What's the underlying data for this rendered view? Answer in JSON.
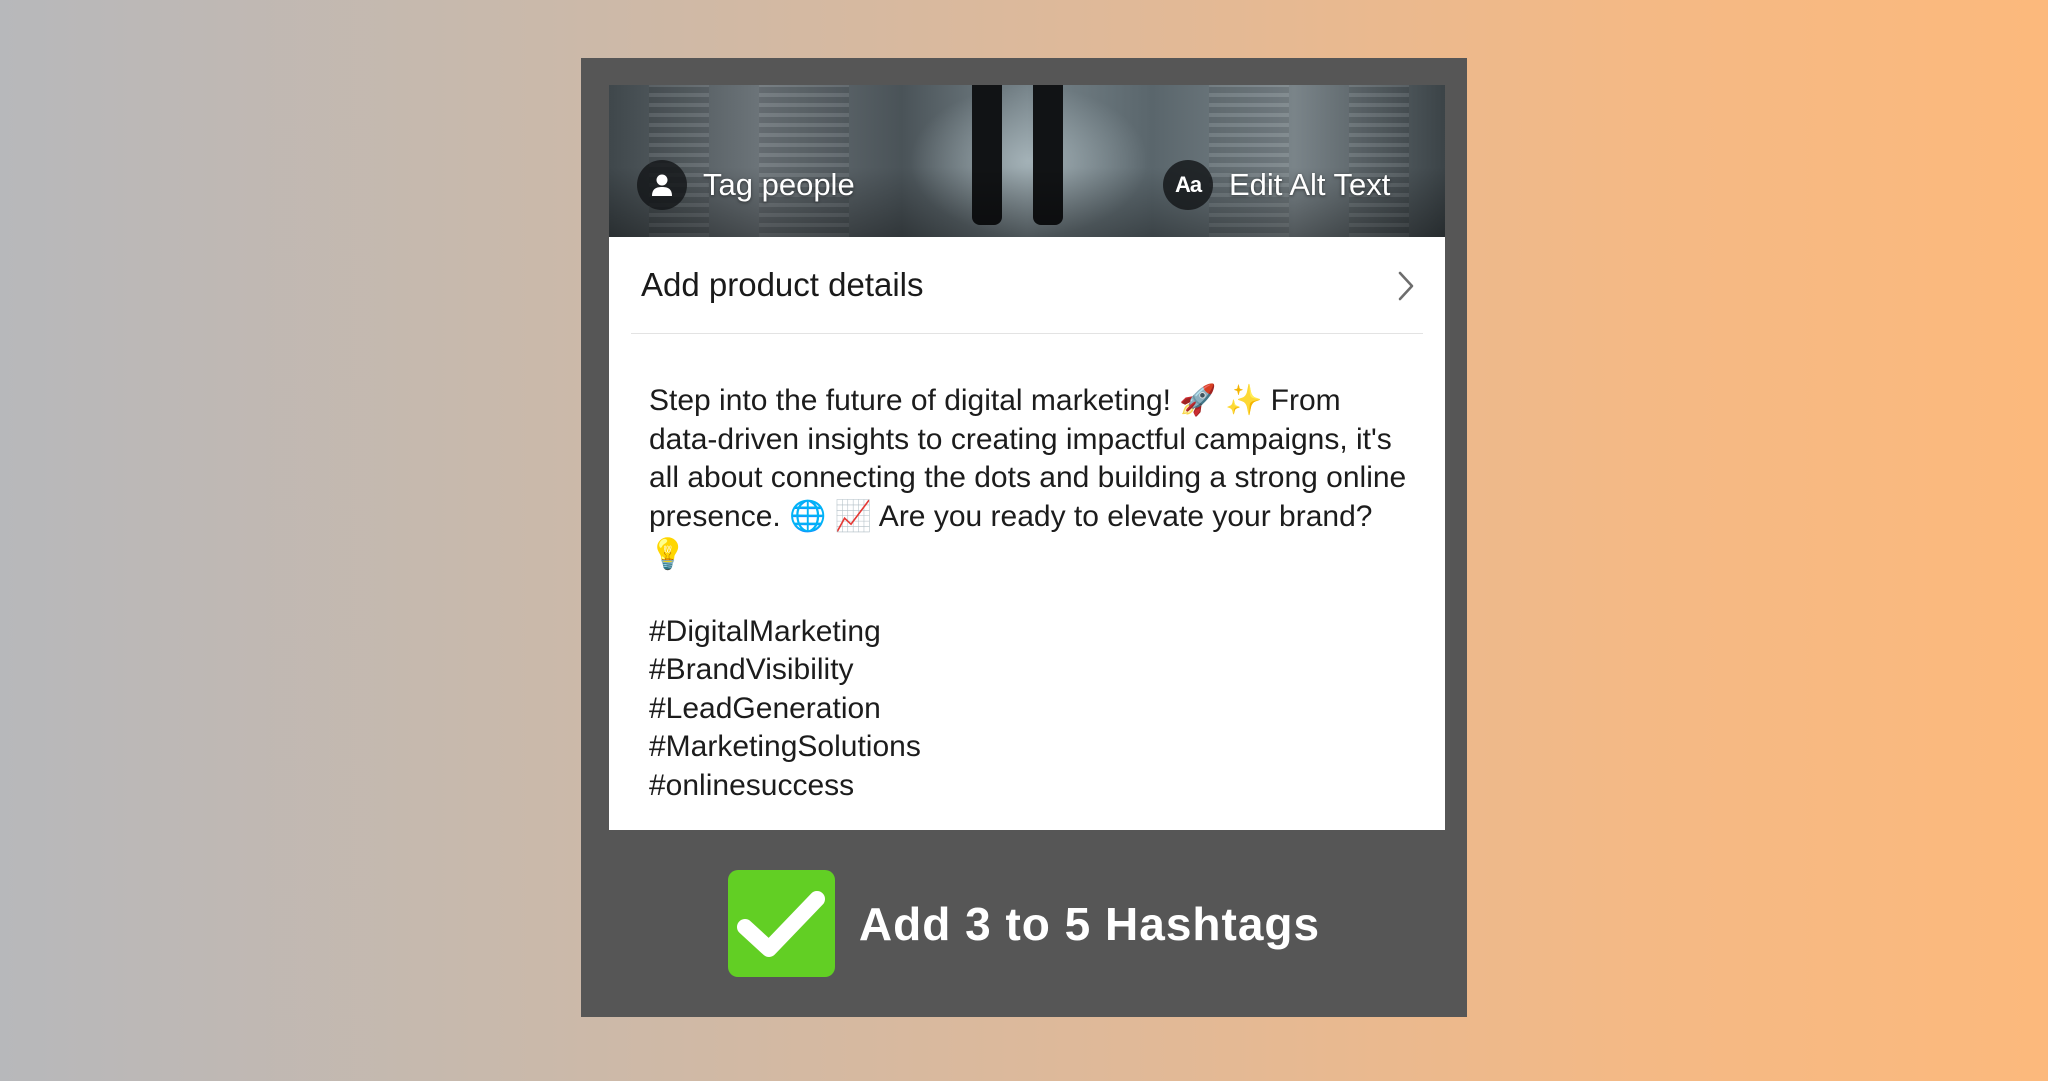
{
  "overlay": {
    "tag_people_label": "Tag people",
    "edit_alt_text_label": "Edit Alt Text",
    "alt_text_icon_glyph": "Aa"
  },
  "product_row": {
    "label": "Add product details"
  },
  "caption": {
    "body": "Step into the future of digital marketing! 🚀 ✨ From data-driven insights to creating impactful campaigns, it's all about connecting the dots and building a strong online presence. 🌐 📈 Are you ready to elevate your brand? 💡",
    "hashtags": [
      "#DigitalMarketing",
      "#BrandVisibility",
      "#LeadGeneration",
      "#MarketingSolutions",
      "#onlinesuccess"
    ]
  },
  "footer": {
    "text": "Add 3 to 5 Hashtags",
    "check_color": "#62cf24"
  },
  "icons": {
    "tag": "person-icon",
    "alt": "alt-text-icon",
    "chevron": "chevron-right-icon",
    "check": "checkmark-icon"
  }
}
